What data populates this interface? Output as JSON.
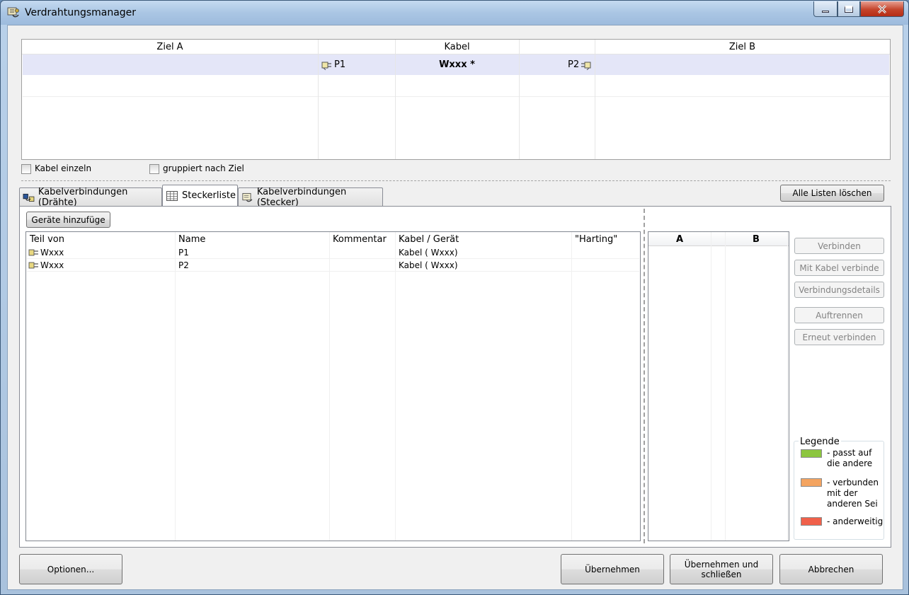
{
  "window": {
    "title": "Verdrahtungsmanager"
  },
  "top_grid": {
    "headers": {
      "ziel_a": "Ziel A",
      "kabel": "Kabel",
      "ziel_b": "Ziel B"
    },
    "row": {
      "p1": "P1",
      "cable": "Wxxx *",
      "p2": "P2"
    }
  },
  "options": {
    "kabel_einzeln": "Kabel einzeln",
    "gruppiert": "gruppiert nach Ziel"
  },
  "tabs": [
    {
      "label": "Kabelverbindungen (Drähte)"
    },
    {
      "label": "Steckerliste"
    },
    {
      "label": "Kabelverbindungen (Stecker)"
    }
  ],
  "buttons": {
    "alle_listen_loeschen": "Alle Listen löschen",
    "geraete_hinzufuegen": "Geräte hinzufüge",
    "verbinden": "Verbinden",
    "mit_kabel_verbinden": "Mit Kabel verbinde",
    "verbindungsdetails": "Verbindungsdetails",
    "auftrennen": "Auftrennen",
    "erneut_verbinden": "Erneut verbinden",
    "optionen": "Optionen...",
    "uebernehmen": "Übernehmen",
    "uebernehmen_schliessen": "Übernehmen und schließen",
    "abbrechen": "Abbrechen"
  },
  "plug_list": {
    "columns": [
      "Teil von",
      "Name",
      "Kommentar",
      "Kabel / Gerät",
      "\"Harting\""
    ],
    "rows": [
      {
        "teil_von": "Wxxx",
        "name": "P1",
        "kommentar": "",
        "kabel": "Kabel ( Wxxx)",
        "harting": ""
      },
      {
        "teil_von": "Wxxx",
        "name": "P2",
        "kommentar": "",
        "kabel": "Kabel ( Wxxx)",
        "harting": ""
      }
    ]
  },
  "ab_list": {
    "col_a": "A",
    "col_b": "B"
  },
  "legend": {
    "title": "Legende",
    "items": [
      {
        "color": "#8cc63f",
        "text": "- passt auf die andere"
      },
      {
        "color": "#f4a460",
        "text": "- verbunden mit der anderen Sei"
      },
      {
        "color": "#f0604a",
        "text": "- anderweitig"
      }
    ]
  }
}
